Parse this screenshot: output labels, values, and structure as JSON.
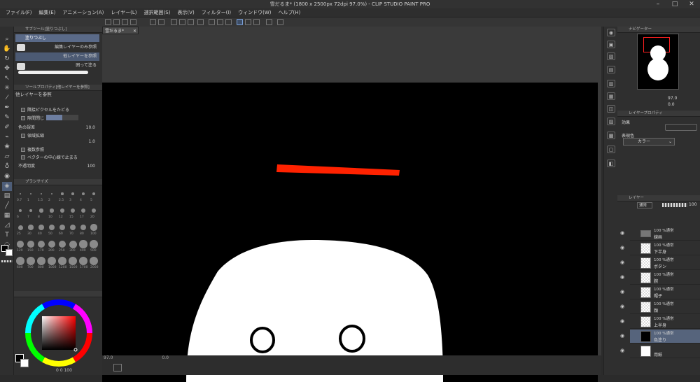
{
  "window": {
    "title": "雪だるま* (1800 x 2500px 72dpi 97.0%)  - CLIP STUDIO PAINT PRO",
    "min": "–",
    "max": "□",
    "close": "✕"
  },
  "menu": [
    "ファイル(F)",
    "編集(E)",
    "アニメーション(A)",
    "レイヤー(L)",
    "選択範囲(S)",
    "表示(V)",
    "フィルター(I)",
    "ウィンドウ(W)",
    "ヘルプ(H)"
  ],
  "subtool": {
    "header": "サブツール[塗りつぶし]",
    "group": "塗りつぶし",
    "items": [
      "編集レイヤーのみ参照",
      "他レイヤーを参照",
      "囲って塗る"
    ]
  },
  "tool_property": {
    "header": "ツールプロパティ[他レイヤーを参照]",
    "title": "他レイヤーを参照",
    "options": [
      {
        "label": "隣接ピクセルをたどる",
        "checked": true
      },
      {
        "label": "隙間閉じ",
        "checked": true
      },
      {
        "label": "色の誤差",
        "value": "10.0"
      },
      {
        "label": "領域拡縮",
        "checked": true,
        "value": "1.0"
      },
      {
        "label": "複数参照",
        "checked": true
      },
      {
        "label": "ベクターの中心線で止まる",
        "checked": false
      },
      {
        "label": "不透明度",
        "value": "100"
      }
    ]
  },
  "brush_size": {
    "header": "ブラシサイズ",
    "sizes": [
      "0.7",
      "1",
      "1.5",
      "2",
      "2.5",
      "3",
      "4",
      "5",
      "6",
      "7",
      "8",
      "10",
      "12",
      "15",
      "17",
      "20",
      "25",
      "30",
      "40",
      "50",
      "60",
      "70",
      "80",
      "100",
      "120",
      "150",
      "170",
      "200",
      "250",
      "300",
      "400",
      "500",
      "600",
      "700",
      "800",
      "1000",
      "1200",
      "1500",
      "1700",
      "2000"
    ]
  },
  "color": {
    "values": "0  0  100"
  },
  "canvas": {
    "tab": "雪だるま*",
    "zoom": "97.0",
    "angle": "0.0",
    "status": "97.0"
  },
  "navigator": {
    "tabs": [
      "ナビゲーター"
    ],
    "zoom": "97.0",
    "angle": "0.0"
  },
  "layer_property": {
    "header": "レイヤープロパティ",
    "effect_label": "効果",
    "expression_label": "表現色",
    "expression_value": "カラー"
  },
  "layers_panel": {
    "tabs": [
      "レイヤー"
    ],
    "blend": "通常",
    "opacity": "100",
    "layers": [
      {
        "pct": "100 %通常",
        "name": "線画",
        "folder": true
      },
      {
        "pct": "100 %通常",
        "name": "下半身"
      },
      {
        "pct": "100 %通常",
        "name": "ボタン"
      },
      {
        "pct": "100 %通常",
        "name": "腕"
      },
      {
        "pct": "100 %通常",
        "name": "帽子"
      },
      {
        "pct": "100 %通常",
        "name": "顔"
      },
      {
        "pct": "100 %通常",
        "name": "上半身"
      },
      {
        "pct": "100 %通常",
        "name": "色塗り",
        "selected": true
      },
      {
        "pct": "",
        "name": "用紙"
      }
    ]
  }
}
